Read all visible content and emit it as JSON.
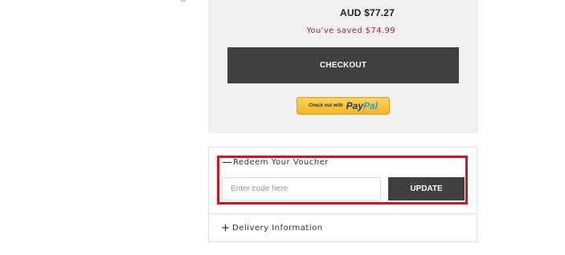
{
  "summary": {
    "total": "AUD $77.27",
    "saved": "You've saved $74.99",
    "checkout_label": "CHECKOUT",
    "paypal": {
      "prefix": "Check out with",
      "logo_pay": "Pay",
      "logo_pal": "Pal"
    }
  },
  "voucher": {
    "title": "Redeem Your Voucher",
    "expanded": true,
    "input_value": "",
    "input_placeholder": "Enter code here",
    "update_label": "UPDATE",
    "highlight_color": "#d8141b"
  },
  "delivery": {
    "title": "Delivery Information",
    "expanded": false
  },
  "icons": {
    "collapse": "—",
    "expand": "+"
  },
  "colors": {
    "button_bg": "#404040",
    "saved_text": "#9b2a2a",
    "panel_bg": "#f0f0f0"
  }
}
